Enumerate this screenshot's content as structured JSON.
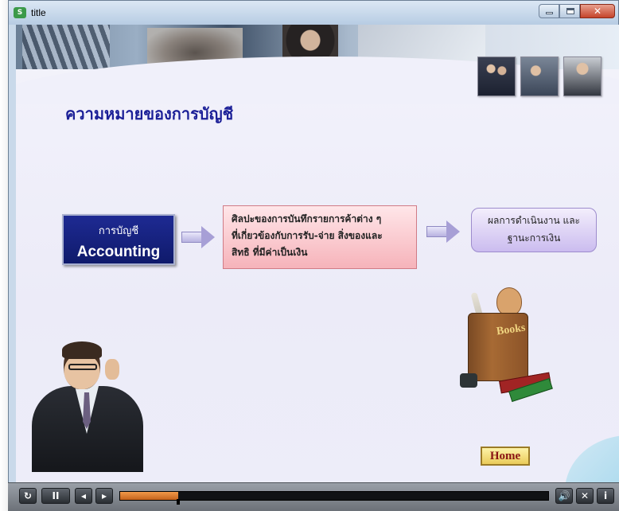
{
  "window": {
    "title": "title",
    "app_icon": "S"
  },
  "slide": {
    "heading": "ความหมายของการบัญชี",
    "accounting_box": {
      "thai": "การบัญชี",
      "english": "Accounting"
    },
    "definition_lines": [
      "ศิลปะของการบันทึกรายการค้าต่าง ๆ",
      "ที่เกี่ยวข้องกับการรับ-จ่าย สิ่งของและ",
      "สิทธิ ที่มีค่าเป็นเงิน"
    ],
    "result_lines": [
      "ผลการดำเนินงาน และ",
      "ฐานะการเงิน"
    ],
    "books_label": "Books",
    "home_label": "Home"
  },
  "player": {
    "progress": 0.135,
    "buttons": {
      "replay": "↻",
      "pause": "II",
      "prev": "◂",
      "next": "▸",
      "volume": "🔊",
      "close": "✕",
      "info": "i"
    }
  },
  "colors": {
    "heading": "#1b1f97",
    "accounting_bg": "#14207e",
    "definition_bg": "#f8c4ca",
    "result_bg": "#ddd2f6",
    "progress": "#e0803a"
  }
}
